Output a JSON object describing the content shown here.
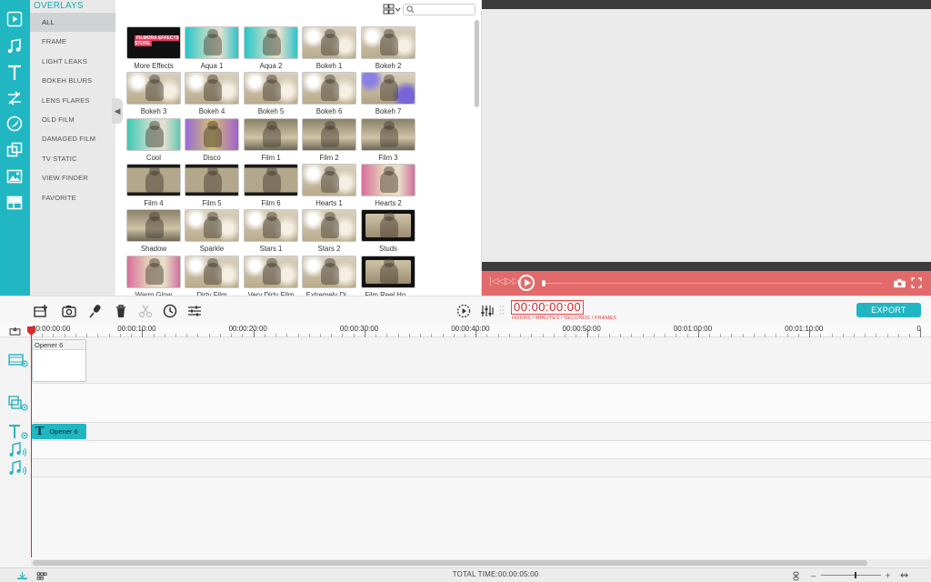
{
  "categories": {
    "heading": "OVERLAYS",
    "items": [
      "ALL",
      "FRAME",
      "LIGHT LEAKS",
      "BOKEH BLURS",
      "LENS FLARES",
      "OLD FILM",
      "DAMAGED FILM",
      "TV STATIC",
      "VIEW FINDER",
      "FAVORITE"
    ],
    "selected": "ALL"
  },
  "rail_icons": [
    "media-icon",
    "music-icon",
    "title-icon",
    "transition-icon",
    "filter-icon",
    "overlay-icon",
    "image-icon",
    "split-screen-icon"
  ],
  "effects_store_logo": "FILMORA EFFECTS STORE",
  "grid": {
    "tiles": [
      {
        "label": "More Effects",
        "style": "store"
      },
      {
        "label": "Aqua 1",
        "style": "aqua"
      },
      {
        "label": "Aqua 2",
        "style": "aqua"
      },
      {
        "label": "Bokeh 1",
        "style": "bokeh"
      },
      {
        "label": "Bokeh 2",
        "style": "bokeh"
      },
      {
        "label": "Bokeh 3",
        "style": "bokeh"
      },
      {
        "label": "Bokeh 4",
        "style": "bokeh"
      },
      {
        "label": "Bokeh 5",
        "style": "bokeh"
      },
      {
        "label": "Bokeh 6",
        "style": "bokeh"
      },
      {
        "label": "Bokeh 7",
        "style": "violet"
      },
      {
        "label": "Cool",
        "style": "cool"
      },
      {
        "label": "Disco",
        "style": "disco"
      },
      {
        "label": "Film 1",
        "style": "film"
      },
      {
        "label": "Film 2",
        "style": "film"
      },
      {
        "label": "Film 3",
        "style": "film"
      },
      {
        "label": "Film 4",
        "style": "dark"
      },
      {
        "label": "Film 5",
        "style": "dark"
      },
      {
        "label": "Film 6",
        "style": "dark"
      },
      {
        "label": "Hearts 1",
        "style": "bokeh"
      },
      {
        "label": "Hearts 2",
        "style": "pink"
      },
      {
        "label": "Shadow",
        "style": "film"
      },
      {
        "label": "Sparkle",
        "style": "bokeh"
      },
      {
        "label": "Stars 1",
        "style": "bokeh"
      },
      {
        "label": "Stars 2",
        "style": "bokeh"
      },
      {
        "label": "Studs",
        "style": "studs"
      },
      {
        "label": "Warm Glow",
        "style": "pink"
      },
      {
        "label": "Dirty Film",
        "style": "bokeh"
      },
      {
        "label": "Very Dirty Film",
        "style": "bokeh"
      },
      {
        "label": "Extremely Di...",
        "style": "bokeh"
      },
      {
        "label": "Film Reel Ho...",
        "style": "studs"
      }
    ]
  },
  "toolbar": {
    "timecode": "00:00:00:00",
    "timecode_label": "HOURS / MINUTES / SECONDS / FRAMES",
    "export_label": "EXPORT"
  },
  "ruler": {
    "labels": [
      "00:00:00:00",
      "00:00:10:00",
      "00:00:20:00",
      "00:00:30:00",
      "00:00:40:00",
      "00:00:50:00",
      "00:01:00:00",
      "00:01:10:00",
      "0"
    ]
  },
  "clips": {
    "video": "Opener 6",
    "text": "Opener 6",
    "text_glyph": "T"
  },
  "status": {
    "total_time": "TOTAL TIME:00:00:05:00",
    "zoom_minus": "–",
    "zoom_plus": "+",
    "fit": "↭"
  },
  "colors": {
    "accent": "#20b7c2",
    "player_bar": "#e26a6a",
    "timecode": "#d62b2b"
  }
}
